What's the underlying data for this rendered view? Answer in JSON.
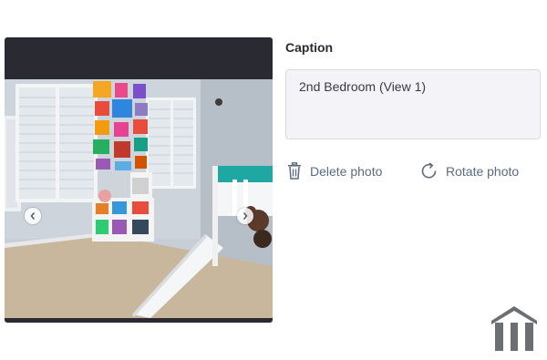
{
  "caption": {
    "label": "Caption",
    "value": "2nd Bedroom (View 1)"
  },
  "actions": {
    "delete_label": "Delete photo",
    "rotate_label": "Rotate photo"
  },
  "icons": {
    "delete": "trash-icon",
    "rotate": "rotate-icon",
    "prev": "chevron-left-icon",
    "next": "chevron-right-icon",
    "logo": "house-logo-icon"
  },
  "colors": {
    "viewer_background": "#2a2a33",
    "action_text": "#5a6b82",
    "caption_background": "#f4f4f8",
    "logo": "#6b6f73"
  }
}
